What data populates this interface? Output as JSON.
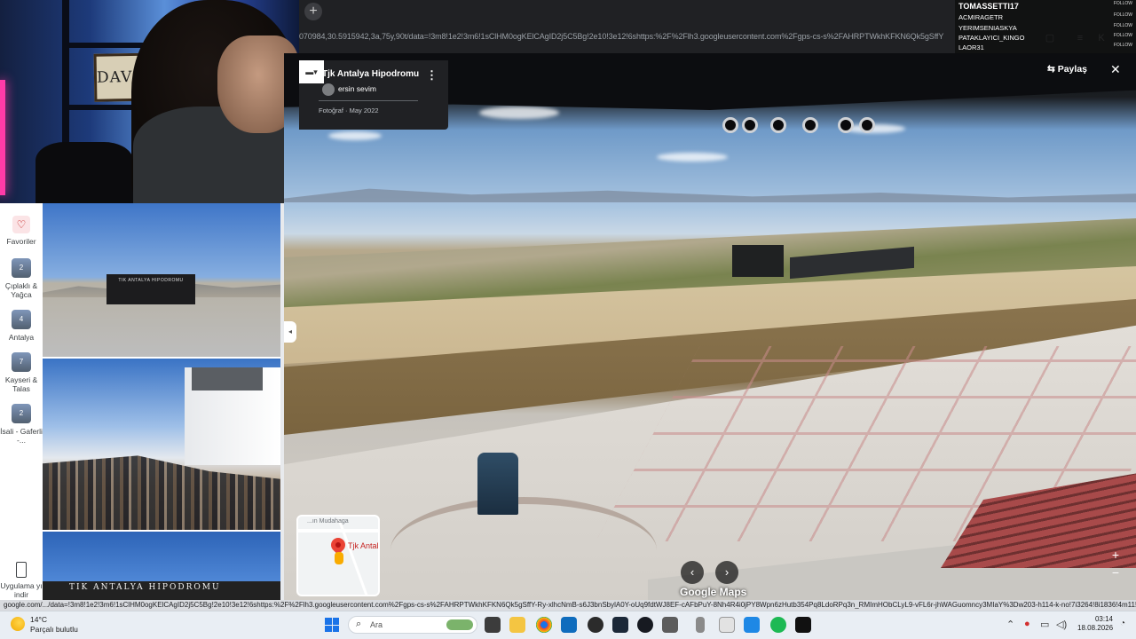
{
  "browser": {
    "url": "070984,30.5915942,3a,75y,90t/data=!3m8!1e2!3m6!1sClHM0ogKElCAgID2j5C5Bg!2e10!3e12!6shttps:%2F%2Flh3.googleusercontent.com%2Fgps-cs-s%2FAHRPTWkhKFKN6Qk5gSffY",
    "status_url": "google.com/.../data=!3m8!1e2!3m6!1sClHM0ogKElCAgID2j5C5Bg!2e10!3e12!6shttps:%2F%2Flh3.googleusercontent.com%2Fgps-cs-s%2FAHRPTWkhKFKN6Qk5gSffY-Ry-xlhcNmB-s6J3bnSbylA0Y-oUq9fdtWJ8EF-cAFbPuY-8Nh4R4i0jPY8Wpn6zHutb354Pq8LdoRPq3n_RMImHObCLyL9-vFL6r-jhWAGuomncy3MIaY%3Dw203-h114-k-no!7i3264!8i1836!4m11!1"
  },
  "chat": {
    "header": "TOMASSETTI17",
    "users": [
      "ACMIRAGETR",
      "YERIMSENIASKYA",
      "PATAKLAYICI_KINGO",
      "LAOR31"
    ],
    "follow_label": "FOLLOW"
  },
  "webcam": {
    "frame_text": "DAVOLTA"
  },
  "rail": {
    "items": [
      {
        "label": "Favoriler",
        "icon": "heart-icon"
      },
      {
        "label": "Çıplaklı & Yağca",
        "badge": "2"
      },
      {
        "label": "Antalya",
        "badge": "4"
      },
      {
        "label": "Kayseri & Talas",
        "badge": "7"
      },
      {
        "label": "İsali - Gaferli -...",
        "badge": "2"
      }
    ],
    "download_label": "Uygulama yı indir"
  },
  "photos": {
    "gate_text": "TIK ANTALYA HIPODROMU",
    "sign_text": "TIK ANTALYA HIPODROMU"
  },
  "viewer": {
    "place_title": "Tjk Antalya Hipodromu",
    "author": "ersin sevim",
    "date": "Fotoğraf · May 2022",
    "share_label": "Paylaş",
    "brand": "Google Maps",
    "minimap_label": "Tjk Antal",
    "minimap_top": "...ın Mudahaga"
  },
  "taskbar": {
    "temperature": "14°C",
    "condition": "Parçalı bulutlu",
    "search_placeholder": "Ara",
    "time": "03:14",
    "date": "18.08.2026"
  },
  "colors": {
    "accent": "#1a73e8",
    "pin": "#ea4335"
  }
}
